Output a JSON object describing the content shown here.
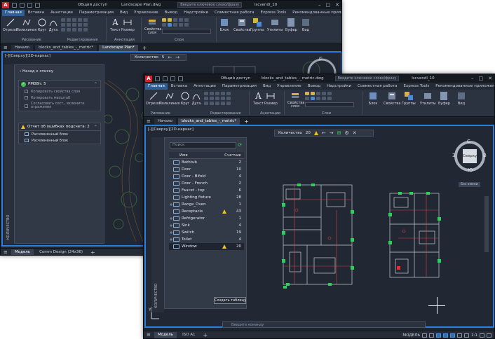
{
  "back_window": {
    "titlebar": {
      "share": "Общий доступ",
      "doc_title": "Landscape Plan.dwg",
      "search_placeholder": "Введите ключевое слово/фразу",
      "user": "lscvendl_10"
    },
    "ribbon_tabs": [
      "Главная",
      "Вставка",
      "Аннотации",
      "Параметризация",
      "Вид",
      "Управление",
      "Вывод",
      "Надстройки",
      "Совместная работа",
      "Express Tools",
      "Рекомендованные приложения"
    ],
    "tools": {
      "line": "Отрезок",
      "polyline": "Полилиния",
      "circle": "Круг",
      "arc": "Дуга",
      "text": "Текст",
      "dimension": "Размер",
      "layer_props": "Свойства слоя",
      "block": "Блок",
      "properties": "Свойства",
      "groups": "Группы",
      "utilities": "Утилиты",
      "clipboard": "Буфер",
      "view": "Вид"
    },
    "panels": {
      "draw": "Рисование",
      "modify": "Редактирование",
      "annotation": "Аннотации",
      "layers": "Слои"
    },
    "doc_tabs": [
      "Начало",
      "blocks_and_tables_-_metric*",
      "Landscape Plan*"
    ],
    "canvas_label": "[-][Сверху][2D-каркас]",
    "filter": {
      "label": "Количество",
      "count": "5"
    },
    "palette": {
      "side_label": "КОЛИЧЕСТВО",
      "back_link": "Назад к списку",
      "section1_title": "PM08h: 5",
      "section1_items": [
        "Копировать свойства слоя",
        "Копировать масштаб",
        "Согласовать сост., включите отражение"
      ],
      "section2_title": "Отчет об ошибках подсчета: 2",
      "section2_items": [
        "Расчлененный блок",
        "Расчлененный блок"
      ]
    },
    "status_tabs": [
      "Модель",
      "Comm Design (24x36)"
    ]
  },
  "front_window": {
    "titlebar": {
      "share": "Общий доступ",
      "doc_title": "blocks_and_tables_-_metric.dwg",
      "search_placeholder": "Введите ключевое слово/фразу",
      "user": "lscvendl_10"
    },
    "ribbon_tabs": [
      "Главная",
      "Вставка",
      "Аннотации",
      "Параметризация",
      "Вид",
      "Управление",
      "Вывод",
      "Надстройки",
      "Совместная работа",
      "Express Tools",
      "Рекомендованные приложения"
    ],
    "tools": {
      "line": "Отрезок",
      "polyline": "Полилиния",
      "circle": "Круг",
      "arc": "Дуга",
      "text": "Текст",
      "dimension": "Размер",
      "layer_props": "Свойства слоя",
      "block": "Блок",
      "properties": "Свойства",
      "groups": "Группы",
      "utilities": "Утилиты",
      "clipboard": "Буфер",
      "view": "Вид"
    },
    "panels": {
      "draw": "Рисование",
      "modify": "Редактирование",
      "annotation": "Аннотации",
      "layers": "Слои"
    },
    "doc_tabs": [
      "Начало",
      "blocks_and_tables_-_metric*"
    ],
    "canvas_label": "[-][Сверху][2D-каркас]",
    "filter": {
      "label": "Количество",
      "count": "20"
    },
    "palette": {
      "side_label": "КОЛИЧЕСТВО",
      "search_placeholder": "Поиск",
      "col_name": "Имя",
      "col_count": "Счетчик",
      "rows": [
        {
          "name": "Bathtub",
          "count": "2",
          "warn": false,
          "exp": ""
        },
        {
          "name": "Door",
          "count": "10",
          "warn": false,
          "exp": ""
        },
        {
          "name": "Door - Bifold",
          "count": "4",
          "warn": false,
          "exp": ""
        },
        {
          "name": "Door - French",
          "count": "2",
          "warn": false,
          "exp": ""
        },
        {
          "name": "Faucet - top",
          "count": "6",
          "warn": false,
          "exp": ""
        },
        {
          "name": "Lighting fixture",
          "count": "28",
          "warn": false,
          "exp": ""
        },
        {
          "name": "Range_Oven",
          "count": "1",
          "warn": false,
          "exp": "+"
        },
        {
          "name": "Receptacle",
          "count": "43",
          "warn": true,
          "exp": ""
        },
        {
          "name": "Refrigerator",
          "count": "1",
          "warn": false,
          "exp": "+"
        },
        {
          "name": "Sink",
          "count": "4",
          "warn": false,
          "exp": "+"
        },
        {
          "name": "Switch",
          "count": "19",
          "warn": false,
          "exp": "+"
        },
        {
          "name": "Toilet",
          "count": "4",
          "warn": false,
          "exp": "+"
        },
        {
          "name": "Window",
          "count": "20",
          "warn": true,
          "exp": "",
          "selected": true
        }
      ],
      "create_button": "Создать таблицу"
    },
    "navcube": {
      "north": "С",
      "south": "Ю",
      "west": "З",
      "east": "В",
      "face": "Сверху",
      "wcs": "Без имени"
    },
    "command_placeholder": "Введите команду",
    "status_tabs": [
      "Модель",
      "ISO A1"
    ],
    "status_right": {
      "model": "МОДЕЛЬ",
      "scale": "1:1"
    }
  },
  "colors": {
    "accent_blue": "#2b7fd8",
    "warning": "#f2c018",
    "ok_green": "#3fbf53",
    "logo_red": "#d6222a"
  }
}
